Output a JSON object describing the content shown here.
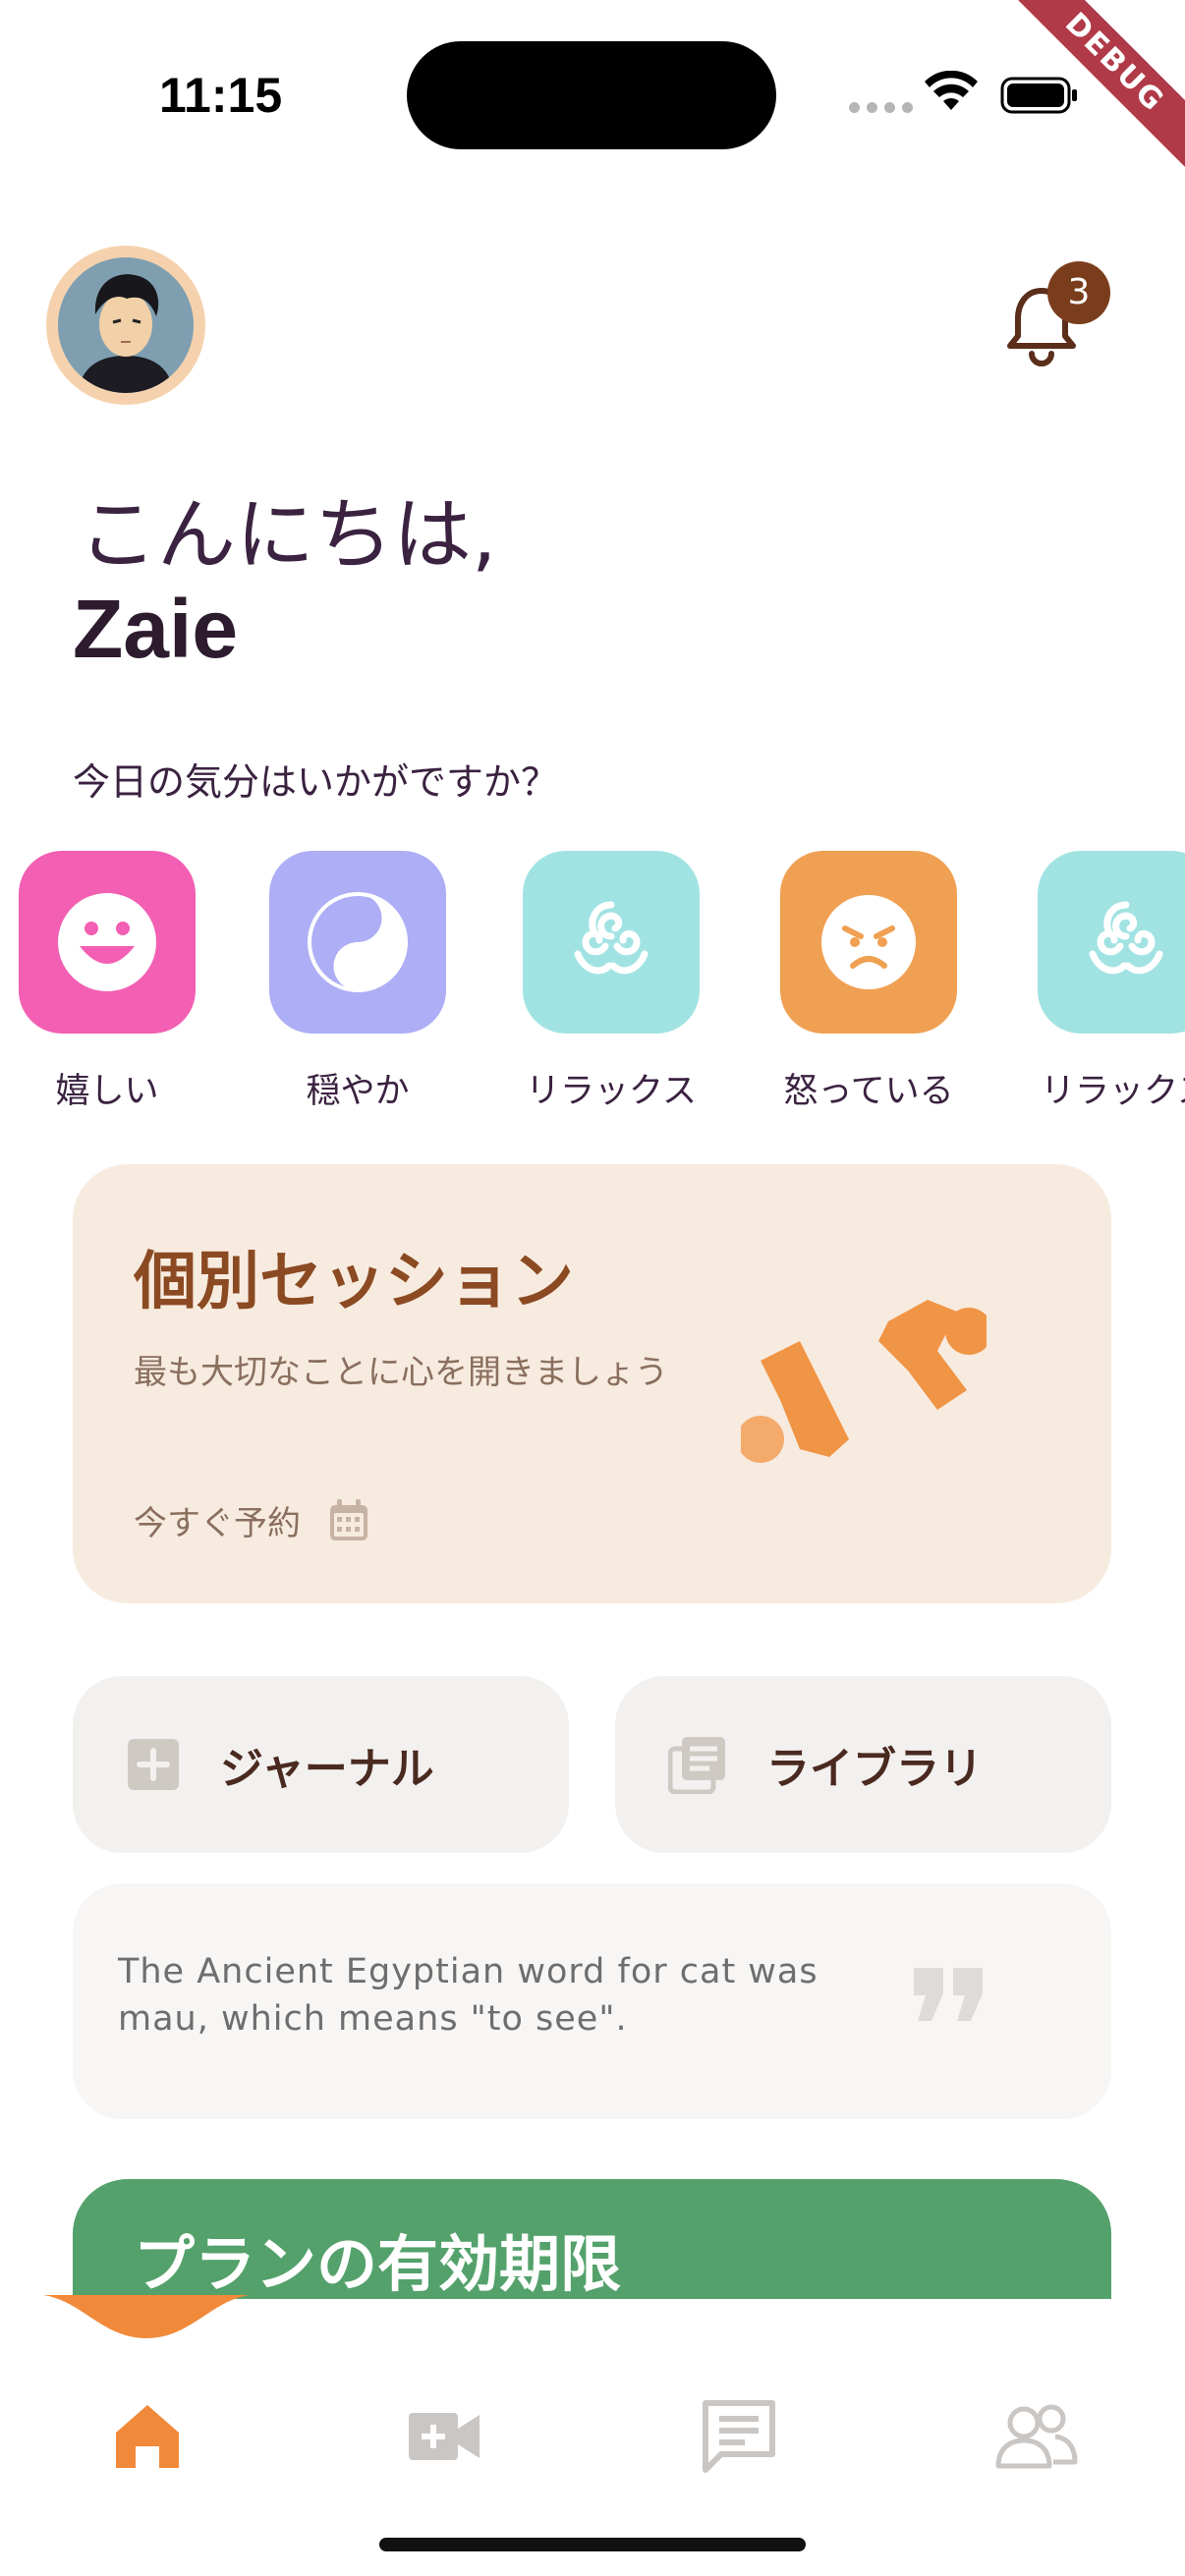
{
  "status_bar": {
    "time": "11:15",
    "debug_label": "DEBUG"
  },
  "header": {
    "notifications_count": "3",
    "greeting": "こんにちは,",
    "username": "Zaie"
  },
  "mood": {
    "question": "今日の気分はいかがですか？",
    "items": [
      {
        "label": "嬉しい",
        "icon": "smile-face-icon",
        "color": "#f25fb3"
      },
      {
        "label": "穏やか",
        "icon": "yin-yang-icon",
        "color": "#adaef5"
      },
      {
        "label": "リラックス",
        "icon": "triple-spiral-icon",
        "color": "#a1e3e2"
      },
      {
        "label": "怒っている",
        "icon": "angry-face-icon",
        "color": "#f0a052"
      },
      {
        "label": "リラックス",
        "icon": "triple-spiral-icon",
        "color": "#a1e3e2"
      }
    ]
  },
  "session_card": {
    "title": "個別セッション",
    "subtitle": "最も大切なことに心を開きましょう",
    "book_label": "今すぐ予約",
    "accent": "#8b4a22",
    "art_color": "#f09445"
  },
  "quick_actions": {
    "journal_label": "ジャーナル",
    "library_label": "ライブラリ"
  },
  "quote": {
    "text": "The Ancient Egyptian word for cat was mau, which means \"to see\"."
  },
  "plan": {
    "title": "プランの有効期限",
    "color": "#54a16c"
  },
  "bottom_nav": {
    "active_color": "#f08a3a",
    "inactive_color": "#c9c6c4",
    "items": [
      "home-icon",
      "video-call-icon",
      "chat-icon",
      "community-icon"
    ]
  }
}
